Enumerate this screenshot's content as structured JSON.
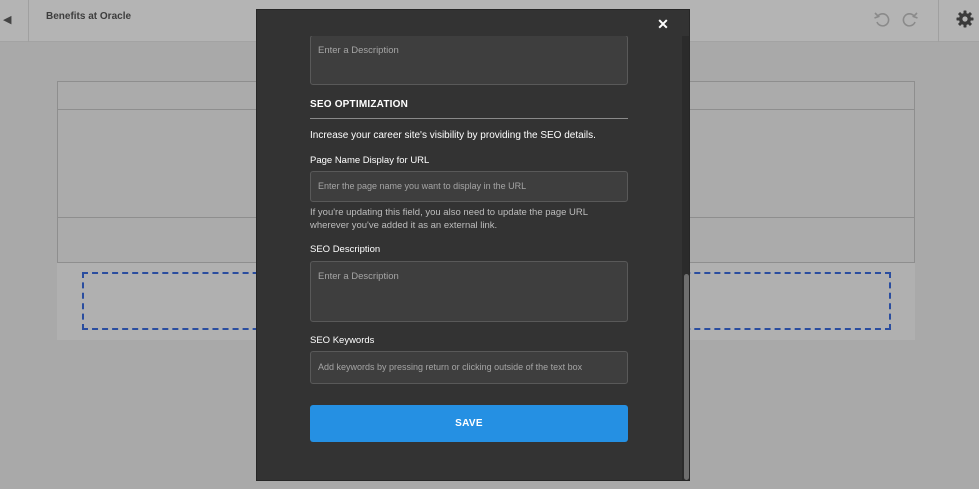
{
  "header": {
    "back_icon": "caret-left-icon",
    "title": "Benefits at Oracle",
    "undo_icon": "undo-icon",
    "redo_icon": "redo-icon",
    "settings_icon": "gear-icon"
  },
  "modal": {
    "close_icon": "close-icon",
    "close_glyph": "✕",
    "top_description_placeholder": "Enter a Description",
    "seo": {
      "heading": "SEO OPTIMIZATION",
      "intro": "Increase your career site's visibility by providing the SEO details.",
      "page_name_label": "Page Name Display for URL",
      "page_name_placeholder": "Enter the page name you want to display in the URL",
      "page_name_help": "If you're updating this field, you also need to update the page URL wherever you've added it as an external link.",
      "description_label": "SEO Description",
      "description_placeholder": "Enter a Description",
      "keywords_label": "SEO Keywords",
      "keywords_placeholder": "Add keywords by pressing return or clicking outside of the text box"
    },
    "save_label": "SAVE"
  },
  "colors": {
    "modal_bg": "#333333",
    "field_bg": "#3e3e3e",
    "save_button": "#2590e3",
    "dashed_outline": "#2a4d9f"
  }
}
